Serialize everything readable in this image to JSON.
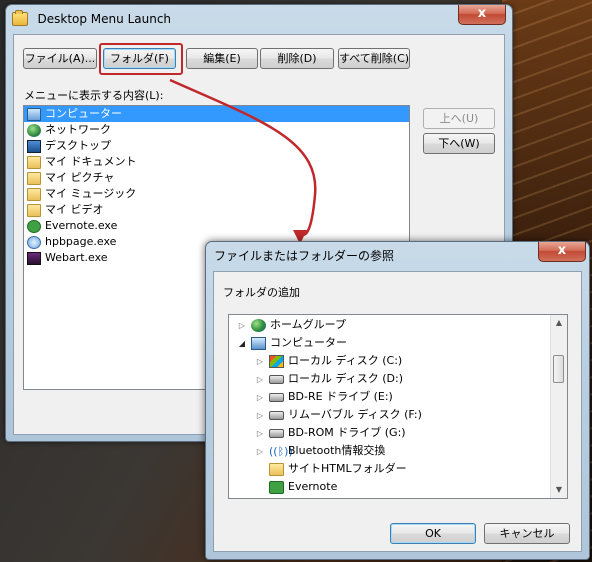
{
  "main_window": {
    "title": "Desktop Menu Launch",
    "close_glyph": "x",
    "buttons": {
      "file": "ファイル(A)...",
      "folder": "フォルダ(F)",
      "edit": "編集(E)",
      "delete": "削除(D)",
      "delete_all": "すべて削除(C)",
      "up": "上へ(U)",
      "down": "下へ(W)"
    },
    "list_label": "メニューに表示する内容(L):",
    "list_items": [
      {
        "label": "コンピューター",
        "icon": "computer-icon",
        "selected": true
      },
      {
        "label": "ネットワーク",
        "icon": "network-icon",
        "selected": false
      },
      {
        "label": "デスクトップ",
        "icon": "desktop-icon",
        "selected": false
      },
      {
        "label": "マイ ドキュメント",
        "icon": "folder-icon",
        "selected": false
      },
      {
        "label": "マイ ピクチャ",
        "icon": "folder-icon",
        "selected": false
      },
      {
        "label": "マイ ミュージック",
        "icon": "folder-icon",
        "selected": false
      },
      {
        "label": "マイ ビデオ",
        "icon": "folder-icon",
        "selected": false
      },
      {
        "label": "Evernote.exe",
        "icon": "evernote-icon",
        "selected": false
      },
      {
        "label": "hpbpage.exe",
        "icon": "hpb-icon",
        "selected": false
      },
      {
        "label": "Webart.exe",
        "icon": "webart-icon",
        "selected": false
      }
    ]
  },
  "dialog": {
    "title": "ファイルまたはフォルダーの参照",
    "close_glyph": "x",
    "label": "フォルダの追加",
    "tree": [
      {
        "label": "ホームグループ",
        "icon": "homegroup-icon",
        "expander": "▷"
      },
      {
        "label": "コンピューター",
        "icon": "computer-icon",
        "expander": "◢"
      },
      {
        "label": "ローカル ディスク (C:)",
        "icon": "windows-drive-icon",
        "expander": "▷"
      },
      {
        "label": "ローカル ディスク (D:)",
        "icon": "drive-icon",
        "expander": "▷"
      },
      {
        "label": "BD-RE ドライブ (E:)",
        "icon": "optical-drive-icon",
        "expander": "▷"
      },
      {
        "label": "リムーバブル ディスク (F:)",
        "icon": "removable-drive-icon",
        "expander": "▷"
      },
      {
        "label": "BD-ROM ドライブ (G:)",
        "icon": "optical-drive-icon",
        "expander": "▷"
      },
      {
        "label": "Bluetooth情報交換",
        "icon": "bluetooth-icon",
        "expander": "▷"
      },
      {
        "label": "サイトHTMLフォルダー",
        "icon": "folder-icon",
        "expander": ""
      },
      {
        "label": "Evernote",
        "icon": "evernote-icon",
        "expander": ""
      }
    ],
    "buttons": {
      "ok": "OK",
      "cancel": "キャンセル"
    }
  },
  "colors": {
    "selection": "#3399ff",
    "annotation": "#c0282c"
  }
}
